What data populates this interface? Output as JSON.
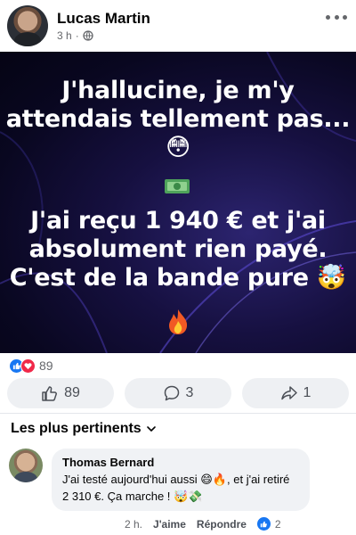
{
  "post": {
    "author": "Lucas Martin",
    "time": "3 h",
    "image_text": {
      "line1": "J'hallucine, je m'y attendais tellement pas... 😳",
      "line2": "J'ai reçu 1 940 € et j'ai absolument rien payé. C'est de la bande pure 🤯"
    }
  },
  "reactions": {
    "count": "89",
    "types": [
      "like",
      "love"
    ]
  },
  "actions": {
    "like_count": "89",
    "comment_count": "3",
    "share_count": "1"
  },
  "comments_filter": "Les plus pertinents",
  "comment": {
    "author": "Thomas Bernard",
    "text": "J'ai testé aujourd'hui aussi 😄🔥, et j'ai retiré 2 310 €. Ça marche ! 🤯💸",
    "time": "2 h.",
    "like_label": "J'aime",
    "reply_label": "Répondre",
    "like_count": "2"
  },
  "colors": {
    "accent": "#1877f2",
    "love": "#f02849",
    "muted": "#65676b",
    "bubble": "#f0f2f5"
  }
}
